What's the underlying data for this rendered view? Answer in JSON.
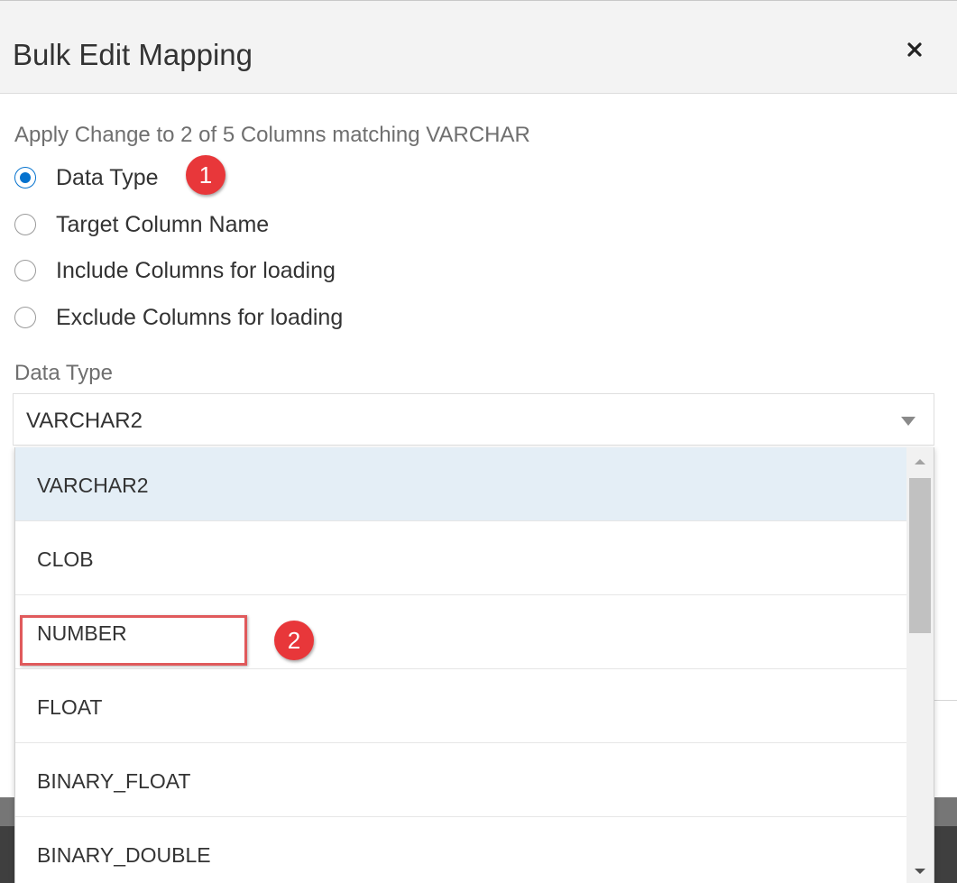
{
  "dialog": {
    "title": "Bulk Edit Mapping",
    "close_icon": "close-icon"
  },
  "hint": "Apply Change to 2 of 5 Columns matching VARCHAR",
  "options": [
    {
      "label": "Data Type",
      "checked": true
    },
    {
      "label": "Target Column Name",
      "checked": false
    },
    {
      "label": "Include Columns for loading",
      "checked": false
    },
    {
      "label": "Exclude Columns for loading",
      "checked": false
    }
  ],
  "field": {
    "label": "Data Type",
    "value": "VARCHAR2",
    "caret_icon": "caret-down-icon"
  },
  "dropdown": {
    "items": [
      {
        "label": "VARCHAR2",
        "selected": true
      },
      {
        "label": "CLOB",
        "selected": false
      },
      {
        "label": "NUMBER",
        "selected": false
      },
      {
        "label": "FLOAT",
        "selected": false
      },
      {
        "label": "BINARY_FLOAT",
        "selected": false
      },
      {
        "label": "BINARY_DOUBLE",
        "selected": false
      }
    ]
  },
  "annotations": {
    "step1": "1",
    "step2": "2"
  },
  "colors": {
    "accent": "#0572ce",
    "badge": "#e8373a",
    "highlight": "#e05a5c",
    "selected_row": "#e4eef6"
  }
}
